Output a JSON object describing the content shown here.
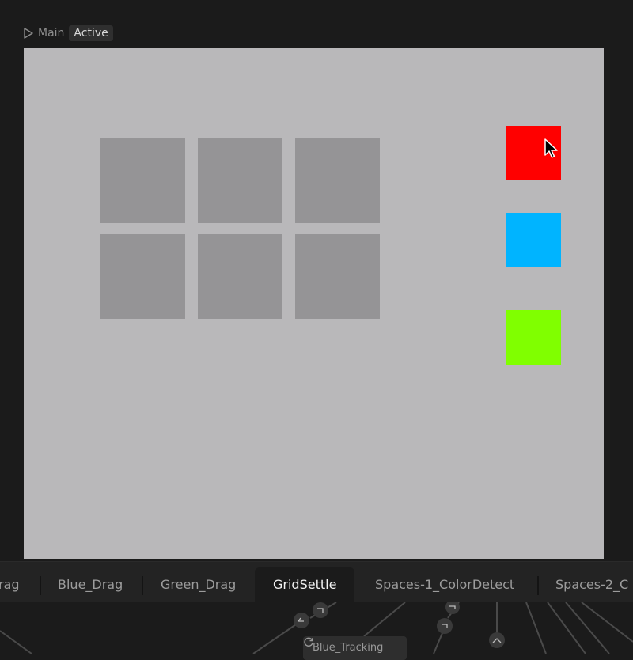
{
  "header": {
    "play_icon": "play-icon",
    "main_label": "Main",
    "status_badge": "Active"
  },
  "canvas": {
    "background": "#b9b8ba",
    "grid_color": "#959496",
    "grid_rows": 2,
    "grid_columns": 3,
    "swatches": [
      {
        "name": "red",
        "color": "#ff0000"
      },
      {
        "name": "blue",
        "color": "#00b4ff"
      },
      {
        "name": "green",
        "color": "#80ff00"
      }
    ],
    "cursor_icon": "pointer-cursor-icon"
  },
  "tabs": [
    {
      "label": "rag"
    },
    {
      "label": "Blue_Drag"
    },
    {
      "label": "Green_Drag"
    },
    {
      "label": "GridSettle",
      "selected": true
    },
    {
      "label": "Spaces-1_ColorDetect"
    },
    {
      "label": "Spaces-2_C"
    }
  ],
  "graph": {
    "node_label": "Blue_Tracking",
    "node_icon": "refresh-icon"
  }
}
